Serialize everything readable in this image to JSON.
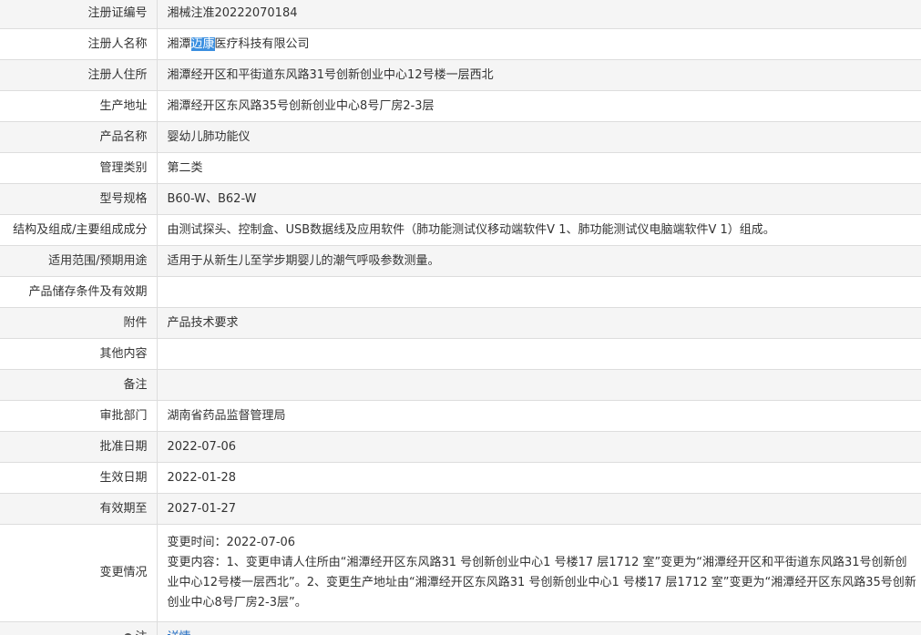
{
  "rows": [
    {
      "label": "注册证编号",
      "value": "湘械注准20222070184"
    },
    {
      "label": "注册人名称",
      "value_before": "湘潭",
      "value_selected": "迈康",
      "value_after": "医疗科技有限公司"
    },
    {
      "label": "注册人住所",
      "value": "湘潭经开区和平街道东风路31号创新创业中心12号楼一层西北"
    },
    {
      "label": "生产地址",
      "value": "湘潭经开区东风路35号创新创业中心8号厂房2-3层"
    },
    {
      "label": "产品名称",
      "value": "婴幼儿肺功能仪"
    },
    {
      "label": "管理类别",
      "value": "第二类"
    },
    {
      "label": "型号规格",
      "value": "B60-W、B62-W"
    },
    {
      "label": "结构及组成/主要组成成分",
      "value": "由测试探头、控制盒、USB数据线及应用软件（肺功能测试仪移动端软件V 1、肺功能测试仪电脑端软件V 1）组成。"
    },
    {
      "label": "适用范围/预期用途",
      "value": "适用于从新生儿至学步期婴儿的潮气呼吸参数测量。"
    },
    {
      "label": "产品储存条件及有效期",
      "value": ""
    },
    {
      "label": "附件",
      "value": "产品技术要求"
    },
    {
      "label": "其他内容",
      "value": ""
    },
    {
      "label": "备注",
      "value": ""
    },
    {
      "label": "审批部门",
      "value": "湖南省药品监督管理局"
    },
    {
      "label": "批准日期",
      "value": "2022-07-06"
    },
    {
      "label": "生效日期",
      "value": "2022-01-28"
    },
    {
      "label": "有效期至",
      "value": "2027-01-27"
    }
  ],
  "change": {
    "label": "变更情况",
    "time_line": "变更时间：2022-07-06",
    "content_text": "变更内容：1、变更申请人住所由“湘潭经开区东风路31 号创新创业中心1 号楼17 层1712 室”变更为“湘潭经开区和平街道东风路31号创新创业中心12号楼一层西北”。2、变更生产地址由“湘潭经开区东风路31 号创新创业中心1 号楼17 层1712 室”变更为“湘潭经开区东风路35号创新创业中心8号厂房2-3层”。"
  },
  "note_row": {
    "label": "注",
    "link_text": "详情",
    "icon": "bullet-icon"
  }
}
